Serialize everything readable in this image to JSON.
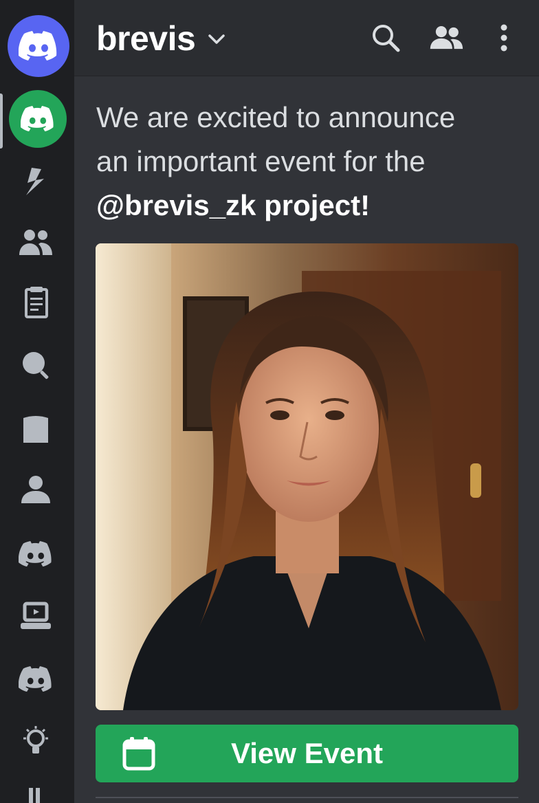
{
  "header": {
    "server_name": "brevis",
    "icons": [
      "chevron-down-icon",
      "search-icon",
      "members-icon",
      "more-vertical-icon"
    ]
  },
  "rail": {
    "items": [
      {
        "name": "discord-home",
        "icon": "discord-logo-icon",
        "color": "#5865f2"
      },
      {
        "name": "server-brevis",
        "icon": "discord-logo-icon",
        "color": "#23a559"
      },
      {
        "name": "lightning",
        "icon": "lightning-icon"
      },
      {
        "name": "group",
        "icon": "group-icon"
      },
      {
        "name": "clipboard",
        "icon": "clipboard-icon"
      },
      {
        "name": "search",
        "icon": "magnifier-icon"
      },
      {
        "name": "folder",
        "icon": "folder-icon"
      },
      {
        "name": "user",
        "icon": "user-icon"
      },
      {
        "name": "discord-server-2",
        "icon": "discord-logo-icon"
      },
      {
        "name": "laptop",
        "icon": "laptop-icon"
      },
      {
        "name": "discord-server-3",
        "icon": "discord-logo-icon"
      },
      {
        "name": "lightbulb",
        "icon": "lightbulb-icon"
      },
      {
        "name": "tools",
        "icon": "tool-icon"
      }
    ]
  },
  "message": {
    "line1": "We are excited to announce",
    "line2": "an important event for the",
    "line3": "@brevis_zk project!",
    "image_alt_icon": "photo-portrait"
  },
  "event_button": {
    "label": "View Event",
    "icon": "calendar-icon",
    "color": "#23a559"
  },
  "colors": {
    "accent_blurple": "#5865f2",
    "green": "#23a559",
    "background": "#313338",
    "rail": "#1e1f22",
    "header": "#2b2d31"
  }
}
